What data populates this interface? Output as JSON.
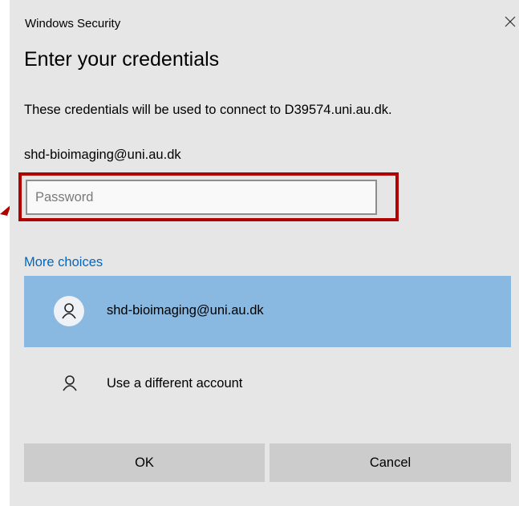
{
  "window": {
    "title": "Windows Security",
    "close_icon": "close-icon"
  },
  "dialog": {
    "heading": "Enter your credentials",
    "description": "These credentials will be used to connect to D39574.uni.au.dk.",
    "username": "shd-bioimaging@uni.au.dk"
  },
  "password_field": {
    "placeholder": "Password",
    "value": ""
  },
  "more_choices": {
    "link_text": "More choices",
    "accounts": [
      {
        "label": "shd-bioimaging@uni.au.dk",
        "icon": "user-icon",
        "selected": true
      },
      {
        "label": "Use a different account",
        "icon": "user-icon",
        "selected": false
      }
    ]
  },
  "buttons": {
    "ok": "OK",
    "cancel": "Cancel"
  },
  "colors": {
    "dialog_bg": "#e6e6e6",
    "selected_bg": "#89b8e0",
    "link": "#0067c0",
    "highlight_border": "#b00000",
    "button_bg": "#cccccc"
  }
}
